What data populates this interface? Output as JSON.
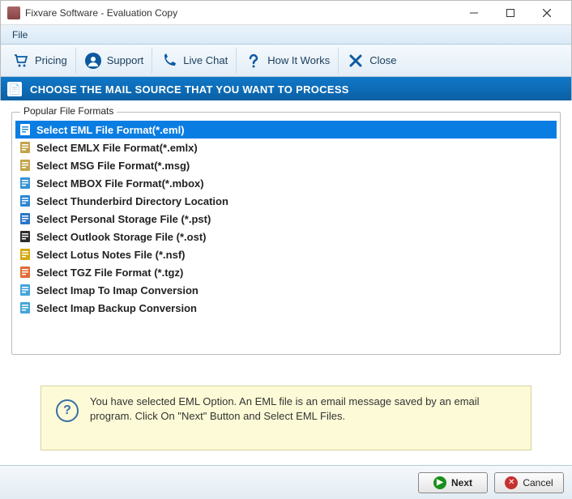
{
  "window": {
    "title": "Fixvare Software - Evaluation Copy"
  },
  "menu": {
    "file": "File"
  },
  "toolbar": {
    "pricing": "Pricing",
    "support": "Support",
    "live_chat": "Live Chat",
    "how_it_works": "How It Works",
    "close": "Close"
  },
  "banner": {
    "text": "CHOOSE THE MAIL SOURCE THAT YOU WANT TO PROCESS"
  },
  "group": {
    "label": "Popular File Formats"
  },
  "formats": [
    {
      "label": "Select EML File Format(*.eml)",
      "icon": "file-eml",
      "selected": true
    },
    {
      "label": "Select EMLX File Format(*.emlx)",
      "icon": "file-emlx",
      "selected": false
    },
    {
      "label": "Select MSG File Format(*.msg)",
      "icon": "file-msg",
      "selected": false
    },
    {
      "label": "Select MBOX File Format(*.mbox)",
      "icon": "file-mbox",
      "selected": false
    },
    {
      "label": "Select Thunderbird Directory Location",
      "icon": "thunderbird",
      "selected": false
    },
    {
      "label": "Select Personal Storage File (*.pst)",
      "icon": "outlook-pst",
      "selected": false
    },
    {
      "label": "Select Outlook Storage File (*.ost)",
      "icon": "outlook-ost",
      "selected": false
    },
    {
      "label": "Select Lotus Notes File (*.nsf)",
      "icon": "lotus",
      "selected": false
    },
    {
      "label": "Select TGZ File Format (*.tgz)",
      "icon": "tgz",
      "selected": false
    },
    {
      "label": "Select Imap To Imap Conversion",
      "icon": "imap-convert",
      "selected": false
    },
    {
      "label": "Select Imap Backup Conversion",
      "icon": "imap-backup",
      "selected": false
    }
  ],
  "info": {
    "text": "You have selected EML Option. An EML file is an email message saved by an email program. Click On \"Next\" Button and Select EML Files."
  },
  "buttons": {
    "next": "Next",
    "cancel": "Cancel"
  },
  "icon_colors": {
    "file-eml": "#2a8dd4",
    "file-emlx": "#c0a040",
    "file-msg": "#c0a040",
    "file-mbox": "#2a8dd4",
    "thunderbird": "#1f7fd4",
    "outlook-pst": "#1d6fc4",
    "outlook-ost": "#222",
    "lotus": "#d2a400",
    "tgz": "#e2622a",
    "imap-convert": "#3aa0d8",
    "imap-backup": "#3aa0d8"
  }
}
